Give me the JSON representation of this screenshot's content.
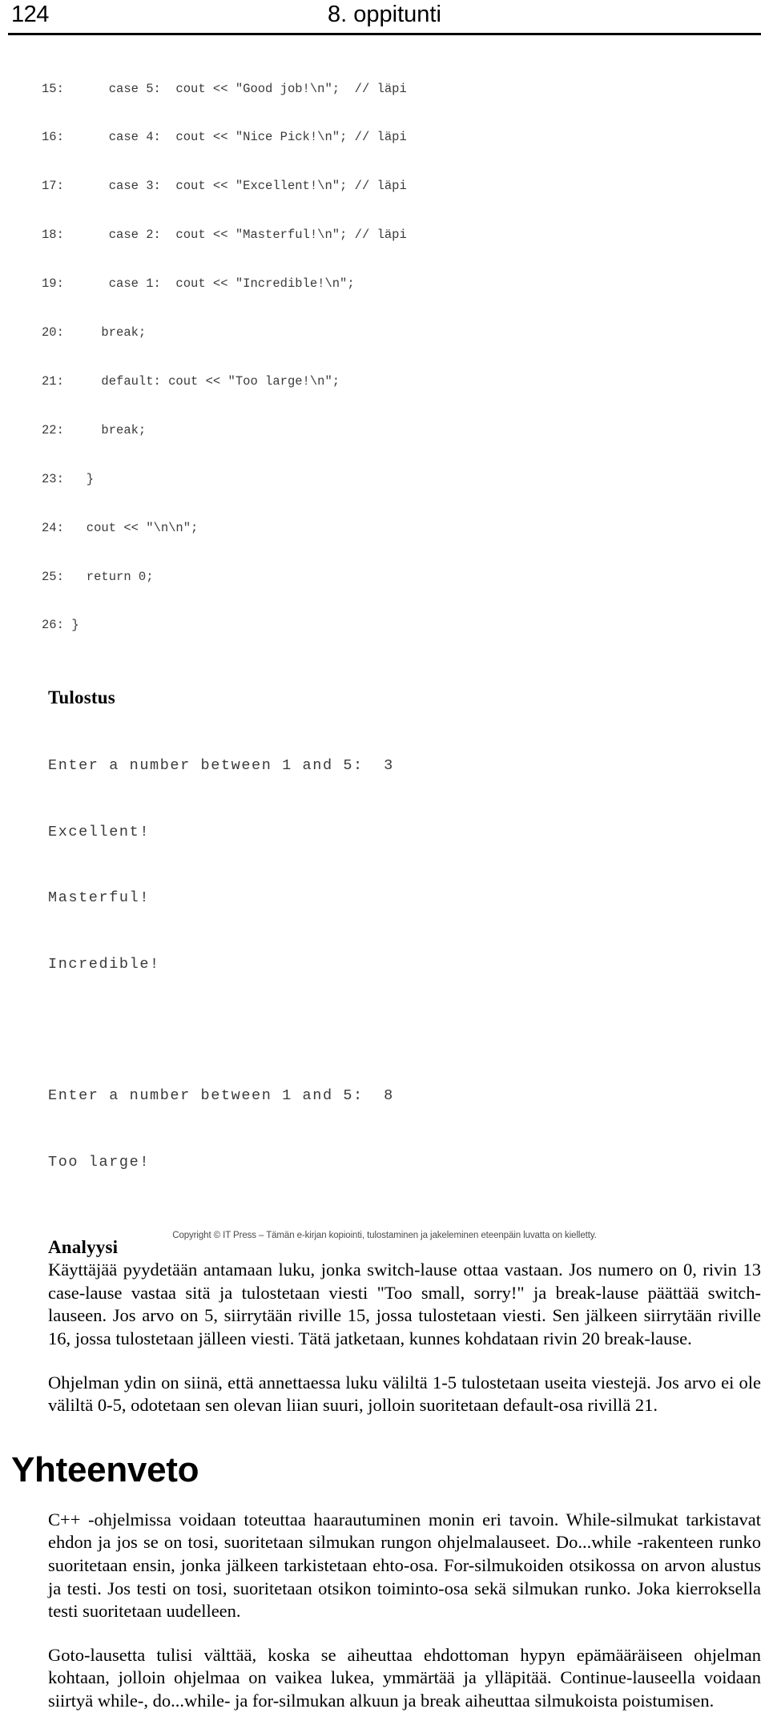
{
  "header": {
    "folio": "124",
    "running_title": "8. oppitunti"
  },
  "code_listing": {
    "lines": [
      "15:      case 5:  cout << \"Good job!\\n\";  // läpi",
      "16:      case 4:  cout << \"Nice Pick!\\n\"; // läpi",
      "17:      case 3:  cout << \"Excellent!\\n\"; // läpi",
      "18:      case 2:  cout << \"Masterful!\\n\"; // läpi",
      "19:      case 1:  cout << \"Incredible!\\n\";",
      "20:     break;",
      "21:     default: cout << \"Too large!\\n\";",
      "22:     break;",
      "23:   }",
      "24:   cout << \"\\n\\n\";",
      "25:   return 0;",
      "26: }"
    ]
  },
  "tulostus": {
    "heading": "Tulostus",
    "lines_before_gap": [
      "Enter a number between 1 and 5:  3",
      "Excellent!",
      "Masterful!",
      "Incredible!"
    ],
    "lines_after_gap": [
      "Enter a number between 1 and 5:  8",
      "Too large!"
    ]
  },
  "analyysi": {
    "heading": "Analyysi",
    "paragraph_1": "Käyttäjää pyydetään antamaan luku, jonka switch-lause ottaa vastaan. Jos numero on 0, rivin 13 case-lause vastaa sitä ja tulostetaan viesti \"Too small, sorry!\" ja break-lause päättää switch-lauseen. Jos arvo on 5, siirrytään riville 15, jossa tulostetaan viesti. Sen jälkeen siirrytään riville 16, jossa tulostetaan jälleen viesti. Tätä jatketaan, kunnes kohdataan rivin 20 break-lause.",
    "paragraph_2": "Ohjelman ydin on siinä, että annettaessa luku väliltä 1-5 tulostetaan useita viestejä. Jos arvo ei ole väliltä 0-5, odotetaan sen olevan liian suuri, jolloin suoritetaan default-osa rivillä 21."
  },
  "yhteenveto": {
    "heading": "Yhteenveto",
    "paragraph_1": "C++ -ohjelmissa voidaan toteuttaa haarautuminen monin eri tavoin. While-silmukat tarkistavat ehdon ja jos se on tosi, suoritetaan silmukan rungon ohjelmalauseet. Do...while -rakenteen runko suoritetaan ensin, jonka jälkeen tarkistetaan ehto-osa. For-silmukoiden otsikossa on arvon alustus ja testi. Jos testi on tosi, suoritetaan otsikon toiminto-osa sekä silmukan runko. Joka kierroksella testi suoritetaan uudelleen.",
    "paragraph_2": "Goto-lausetta tulisi välttää, koska se aiheuttaa ehdottoman hypyn epämääräiseen ohjelman kohtaan, jolloin ohjelmaa on vaikea lukea, ymmärtää ja ylläpitää. Continue-lauseella voidaan siirtyä while-, do...while- ja for-silmukan alkuun ja break aiheuttaa silmukoista poistumisen."
  },
  "footer": {
    "copyright": "Copyright © IT Press – Tämän e-kirjan kopiointi, tulostaminen ja jakeleminen eteenpäin luvatta on kielletty."
  },
  "colors": {
    "text": "#000000",
    "code_text": "#3a3a3a",
    "rule": "#000000",
    "footer_text": "#4a4a4a"
  }
}
